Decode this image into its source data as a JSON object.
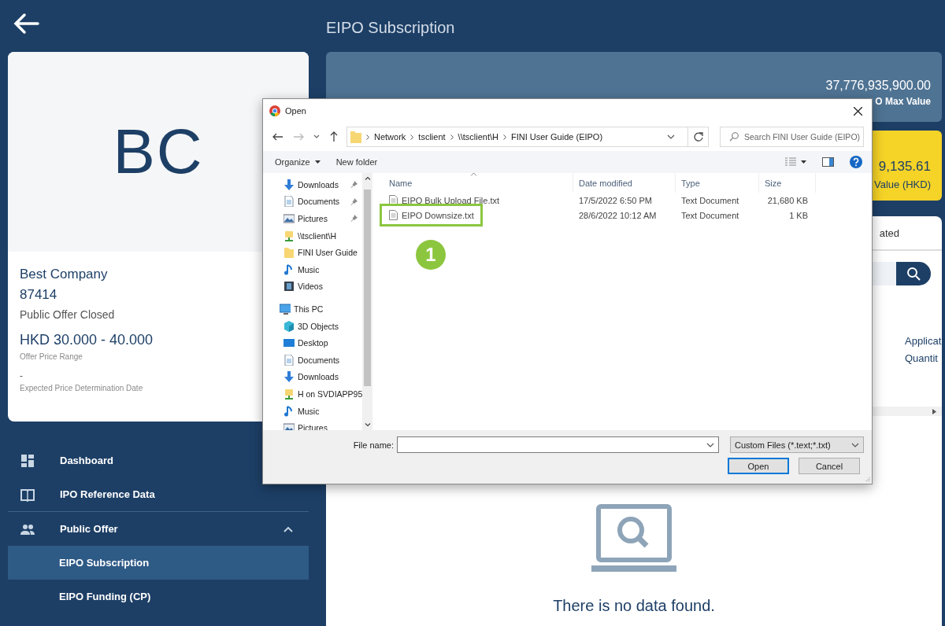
{
  "app": {
    "title": "EIPO Subscription"
  },
  "company_card": {
    "avatar_initials": "BC",
    "name": "Best Company",
    "code": "87414",
    "status": "Public Offer Closed",
    "price_range": "HKD 30.000 - 40.000",
    "price_range_label": "Offer Price Range",
    "determination_date": "-",
    "determination_date_label": "Expected Price Determination Date"
  },
  "sidebar": {
    "items": [
      {
        "label": "Dashboard",
        "kind": "dashboard",
        "selected": false
      },
      {
        "label": "IPO Reference Data",
        "kind": "book",
        "selected": false
      },
      {
        "label": "Public Offer",
        "kind": "people",
        "selected": false,
        "expanded": true,
        "children": [
          {
            "label": "EIPO Subscription",
            "selected": true
          },
          {
            "label": "EIPO Funding (CP)",
            "selected": false
          }
        ]
      }
    ]
  },
  "summary_cards": [
    {
      "kind": "max",
      "value": "37,776,935,900.00",
      "label": "O Max Value"
    },
    {
      "kind": "highlight",
      "value": "9,135.61",
      "label": "Value (HKD)"
    }
  ],
  "panel": {
    "tab_label": "ated",
    "column_headers": [
      "Applicat",
      "Quantit"
    ],
    "empty_message": "There is no data found."
  },
  "dialog": {
    "title": "Open",
    "breadcrumb": [
      "Network",
      "tsclient",
      "\\\\tsclient\\H",
      "FINI User Guide (EIPO)"
    ],
    "search": {
      "placeholder": "Search FINI User Guide (EIPO)"
    },
    "toolbar": [
      "Organize",
      "New folder"
    ],
    "quick_access_items": [
      {
        "label": "Downloads",
        "kind": "download",
        "pinned": true
      },
      {
        "label": "Documents",
        "kind": "document",
        "pinned": true
      },
      {
        "label": "Pictures",
        "kind": "picture",
        "pinned": true
      },
      {
        "label": "\\\\tsclient\\H",
        "kind": "network",
        "pinned": false
      },
      {
        "label": "FINI User Guide",
        "kind": "folder",
        "pinned": false
      },
      {
        "label": "Music",
        "kind": "music",
        "pinned": false
      },
      {
        "label": "Videos",
        "kind": "video",
        "pinned": false
      }
    ],
    "this_pc": {
      "label": "This PC",
      "children": [
        {
          "label": "3D Objects",
          "kind": "cube"
        },
        {
          "label": "Desktop",
          "kind": "desktop"
        },
        {
          "label": "Documents",
          "kind": "document"
        },
        {
          "label": "Downloads",
          "kind": "download"
        },
        {
          "label": "H on SVDIAPP95",
          "kind": "network"
        },
        {
          "label": "Music",
          "kind": "music"
        },
        {
          "label": "Pictures",
          "kind": "picture"
        }
      ]
    },
    "columns": [
      "Name",
      "Date modified",
      "Type",
      "Size"
    ],
    "files": [
      {
        "name": "EIPO Bulk Upload File.txt",
        "date": "17/5/2022 6:50 PM",
        "type": "Text Document",
        "size": "21,680 KB",
        "highlighted": false
      },
      {
        "name": "EIPO Downsize.txt",
        "date": "28/6/2022 10:12 AM",
        "type": "Text Document",
        "size": "1 KB",
        "highlighted": true
      }
    ],
    "step_marker": "1",
    "file_name_label": "File name:",
    "file_type": "Custom Files (*.text;*.txt)",
    "buttons": [
      {
        "label": "Open",
        "default": true
      },
      {
        "label": "Cancel",
        "default": false
      }
    ]
  }
}
